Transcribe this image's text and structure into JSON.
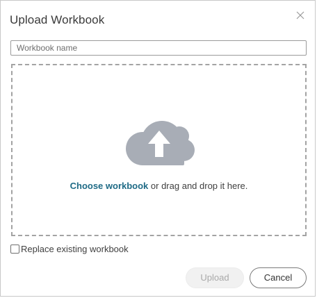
{
  "dialog": {
    "title": "Upload Workbook",
    "close_icon": "close-icon"
  },
  "name_input": {
    "value": "",
    "placeholder": "Workbook name"
  },
  "dropzone": {
    "icon": "cloud-upload-icon",
    "link_text": "Choose workbook",
    "rest_text": " or drag and drop it here."
  },
  "replace": {
    "label": "Replace existing workbook",
    "checked": false
  },
  "buttons": {
    "upload_label": "Upload",
    "upload_enabled": false,
    "cancel_label": "Cancel"
  },
  "colors": {
    "link": "#1f6b86",
    "cloud": "#a8adb6",
    "border_dashed": "#a3a3a3"
  }
}
